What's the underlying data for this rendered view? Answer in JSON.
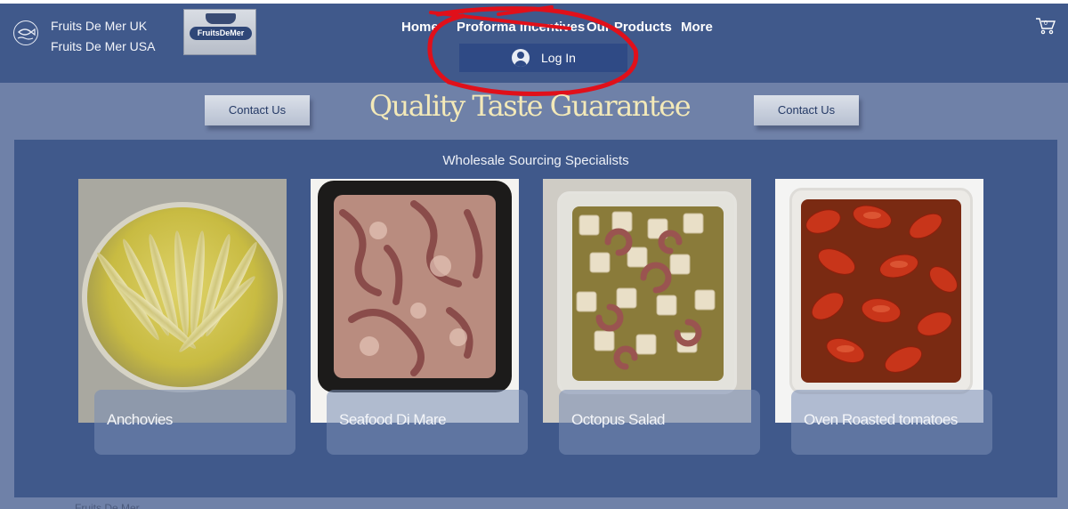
{
  "header": {
    "regions": [
      "Fruits De Mer UK",
      "Fruits De Mer USA"
    ],
    "brand_logo_text": "FruitsDeMer",
    "nav": [
      "Home",
      "Proforma Incentives",
      "Our Products",
      "More"
    ],
    "login_label": "Log In"
  },
  "hero": {
    "title": "Quality Taste Guarantee",
    "contact_left": "Contact Us",
    "contact_right": "Contact Us"
  },
  "products": {
    "subtitle": "Wholesale Sourcing Specialists",
    "items": [
      {
        "name": "Anchovies"
      },
      {
        "name": "Seafood Di Mare"
      },
      {
        "name": "Octopus Salad"
      },
      {
        "name": "Oven Roasted tomatoes"
      }
    ]
  },
  "footer": {
    "text": "Fruits De Mer"
  },
  "colors": {
    "header_bg": "#40598b",
    "page_bg": "#6f81a8",
    "title_color": "#f3e9b8",
    "annotation_red": "#e0101a"
  },
  "icons": [
    "fish-logo-icon",
    "user-avatar-icon",
    "cart-icon"
  ]
}
